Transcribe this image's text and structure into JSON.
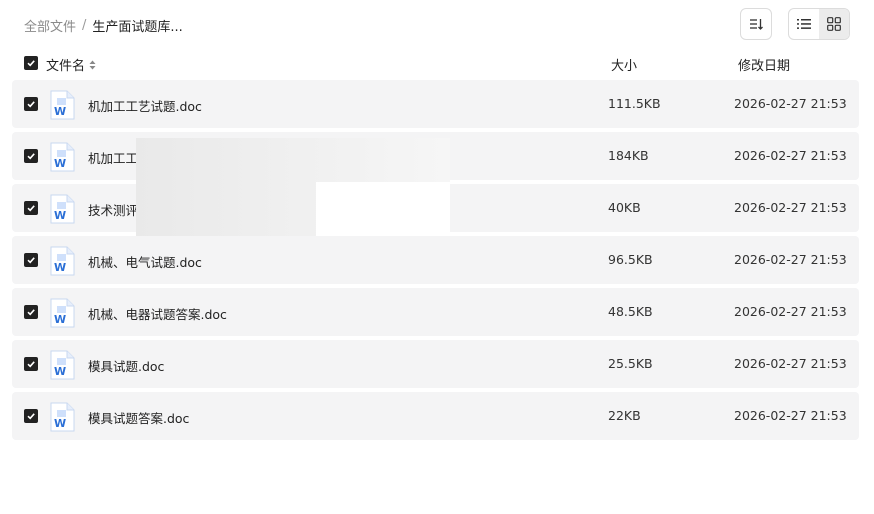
{
  "breadcrumb": {
    "root": "全部文件",
    "separator": "/",
    "current": "生产面试题库..."
  },
  "toolbar": {
    "sort_icon": "sort-icon",
    "list_view_icon": "list-view-icon",
    "grid_view_icon": "grid-view-icon"
  },
  "header": {
    "name": "文件名",
    "size": "大小",
    "date": "修改日期"
  },
  "files": [
    {
      "name": "机加工工艺试题.doc",
      "size": "111.5KB",
      "date": "2026-02-27 21:53"
    },
    {
      "name": "机加工工",
      "size": "184KB",
      "date": "2026-02-27 21:53"
    },
    {
      "name": "技术测评",
      "size": "40KB",
      "date": "2026-02-27 21:53"
    },
    {
      "name": "机械、电气试题.doc",
      "size": "96.5KB",
      "date": "2026-02-27 21:53"
    },
    {
      "name": "机械、电器试题答案.doc",
      "size": "48.5KB",
      "date": "2026-02-27 21:53"
    },
    {
      "name": "模具试题.doc",
      "size": "25.5KB",
      "date": "2026-02-27 21:53"
    },
    {
      "name": "模具试题答案.doc",
      "size": "22KB",
      "date": "2026-02-27 21:53"
    }
  ],
  "colors": {
    "row_bg": "#f4f4f5",
    "checkbox": "#222222",
    "word_blue": "#2b6fd6"
  }
}
